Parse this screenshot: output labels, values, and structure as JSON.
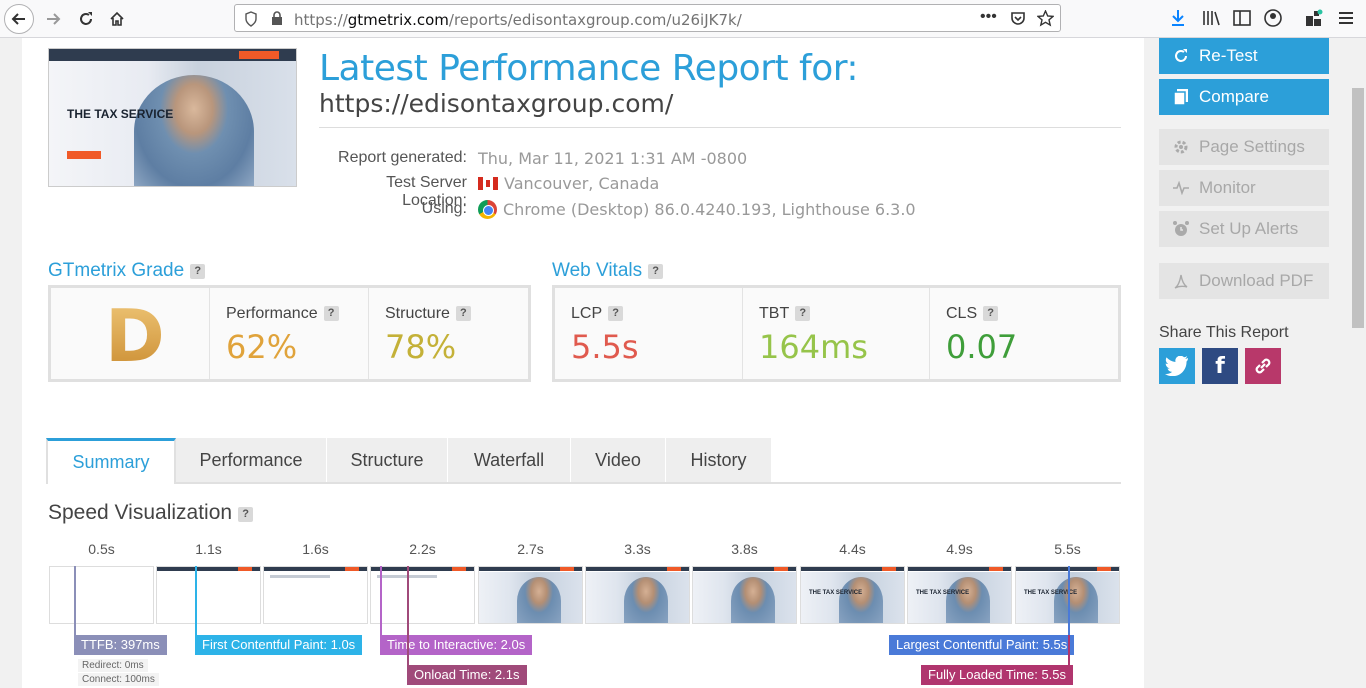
{
  "browser": {
    "url_prefix": "https://",
    "url_domain": "gtmetrix.com",
    "url_path": "/reports/edisontaxgroup.com/u26iJK7k/",
    "more_icon": "ellipsis-icon"
  },
  "report": {
    "title": "Latest Performance Report for:",
    "url": "https://edisontaxgroup.com/",
    "thumbnail_heading": "THE TAX SERVICE",
    "meta": [
      {
        "label": "Report generated:",
        "value": "Thu, Mar 11, 2021 1:31 AM -0800"
      },
      {
        "label": "Test Server Location:",
        "value": "Vancouver, Canada"
      },
      {
        "label": "Using:",
        "value": "Chrome (Desktop) 86.0.4240.193, Lighthouse 6.3.0"
      }
    ]
  },
  "grade": {
    "title": "GTmetrix Grade",
    "help": "?",
    "letter": "D",
    "performance_label": "Performance",
    "performance_value": "62%",
    "structure_label": "Structure",
    "structure_value": "78%",
    "colors": {
      "grade": "#d89a3e",
      "performance": "#e0a33b",
      "structure": "#c4b138"
    }
  },
  "vitals": {
    "title": "Web Vitals",
    "help": "?",
    "lcp_label": "LCP",
    "lcp_value": "5.5s",
    "tbt_label": "TBT",
    "tbt_value": "164ms",
    "cls_label": "CLS",
    "cls_value": "0.07",
    "colors": {
      "lcp": "#e05a4e",
      "tbt": "#96c44a",
      "cls": "#3f9e3a"
    }
  },
  "tabs": [
    "Summary",
    "Performance",
    "Structure",
    "Waterfall",
    "Video",
    "History"
  ],
  "active_tab": "Summary",
  "speed": {
    "title": "Speed Visualization",
    "help": "?",
    "ticks": [
      "0.5s",
      "1.1s",
      "1.6s",
      "2.2s",
      "2.7s",
      "3.3s",
      "3.8s",
      "4.4s",
      "4.9s",
      "5.5s"
    ],
    "markers": {
      "ttfb": "TTFB: 397ms",
      "redirect": "Redirect: 0ms",
      "connect": "Connect: 100ms",
      "fcp": "First Contentful Paint: 1.0s",
      "tti": "Time to Interactive: 2.0s",
      "onload": "Onload Time: 2.1s",
      "lcp": "Largest Contentful Paint: 5.5s",
      "fully": "Fully Loaded Time: 5.5s"
    },
    "frame_text": "THE TAX SERVICE"
  },
  "sidebar": {
    "retest": "Re-Test",
    "compare": "Compare",
    "page_settings": "Page Settings",
    "monitor": "Monitor",
    "alerts": "Set Up Alerts",
    "download": "Download PDF",
    "share_title": "Share This Report",
    "facebook_glyph": "f"
  }
}
